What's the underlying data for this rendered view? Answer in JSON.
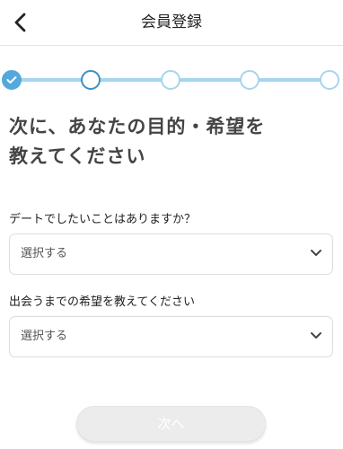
{
  "header": {
    "back_icon": "chevron-left-icon",
    "title": "会員登録"
  },
  "stepper": {
    "total_steps": 5,
    "completed_steps": 1,
    "current_step": 2,
    "done_icon": "check-icon",
    "colors": {
      "line": "#a7d4ee",
      "done": "#55a8dc",
      "current": "#3d8fc3"
    }
  },
  "lead": {
    "line1": "次に、あなたの目的・希望を",
    "line2": "教えてください"
  },
  "questions": [
    {
      "label": "デートでしたいことはありますか？",
      "selected": "選択する",
      "icon": "chevron-down-icon"
    },
    {
      "label": "出会うまでの希望を教えてください",
      "selected": "選択する",
      "icon": "chevron-down-icon"
    }
  ],
  "footer": {
    "next_label": "次へ",
    "next_state": "disabled"
  }
}
